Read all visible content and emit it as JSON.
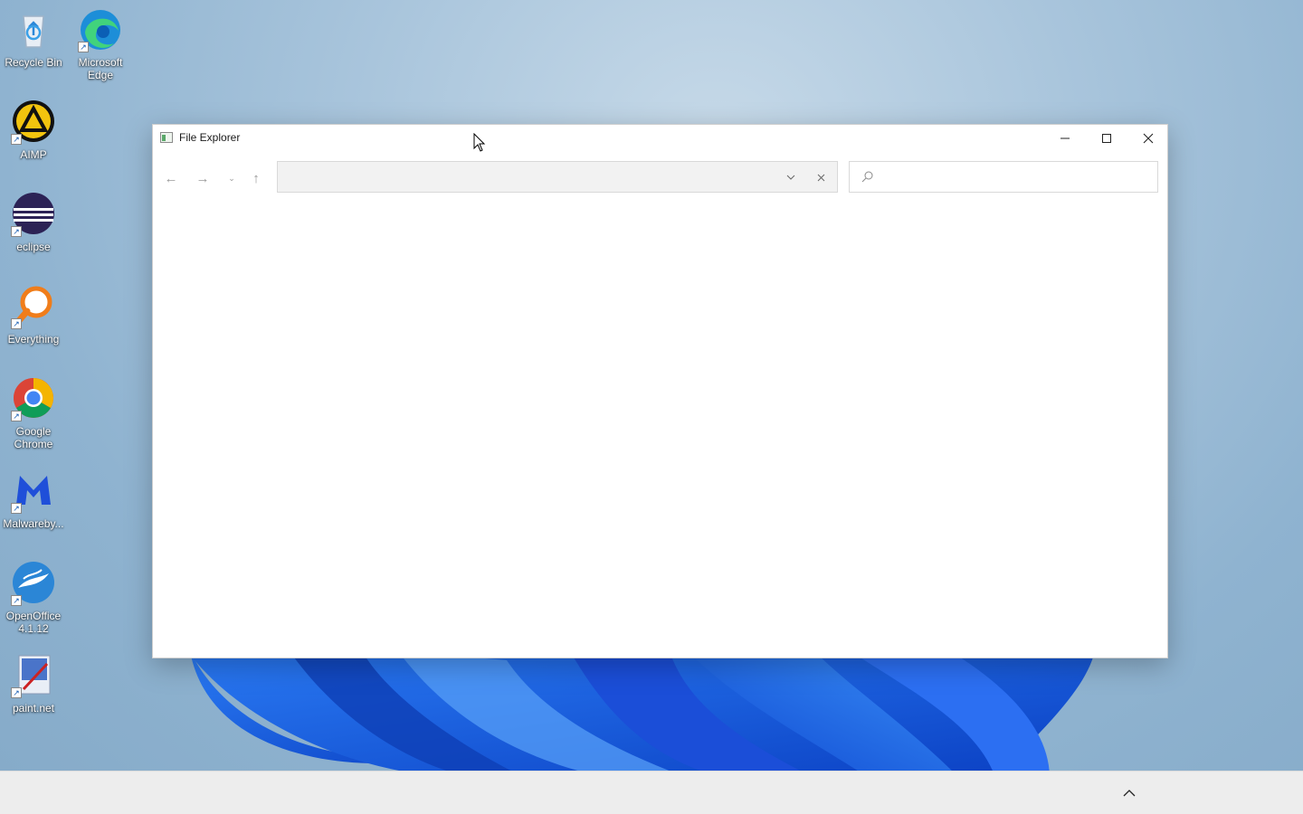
{
  "desktop": {
    "icons": [
      {
        "label": "Recycle Bin",
        "icon": "recycle-bin-icon"
      },
      {
        "label": "Microsoft Edge",
        "icon": "edge-icon"
      },
      {
        "label": "AIMP",
        "icon": "aimp-icon"
      },
      {
        "label": "eclipse",
        "icon": "eclipse-icon"
      },
      {
        "label": "Everything",
        "icon": "everything-icon"
      },
      {
        "label": "Google Chrome",
        "icon": "chrome-icon"
      },
      {
        "label": "Malwareby...",
        "icon": "malwarebytes-icon"
      },
      {
        "label": "OpenOffice 4.1.12",
        "icon": "openoffice-icon"
      },
      {
        "label": "paint.net",
        "icon": "paintnet-icon"
      }
    ]
  },
  "window": {
    "title": "File Explorer",
    "controls": {
      "minimize": "—",
      "maximize": "☐",
      "close": "✕"
    },
    "nav": {
      "back": "←",
      "forward": "→",
      "recent": "⌄",
      "up": "↑"
    },
    "address": {
      "value": "",
      "dropdown": "⌄",
      "clear": "✕"
    },
    "search": {
      "placeholder": ""
    }
  },
  "taskbar": {
    "tray_chevron": "^"
  },
  "colors": {
    "wallpaper": "#a9c5dc",
    "bloom": "#1f5fe0",
    "window_bg": "#ffffff",
    "taskbar_bg": "#ededed"
  }
}
